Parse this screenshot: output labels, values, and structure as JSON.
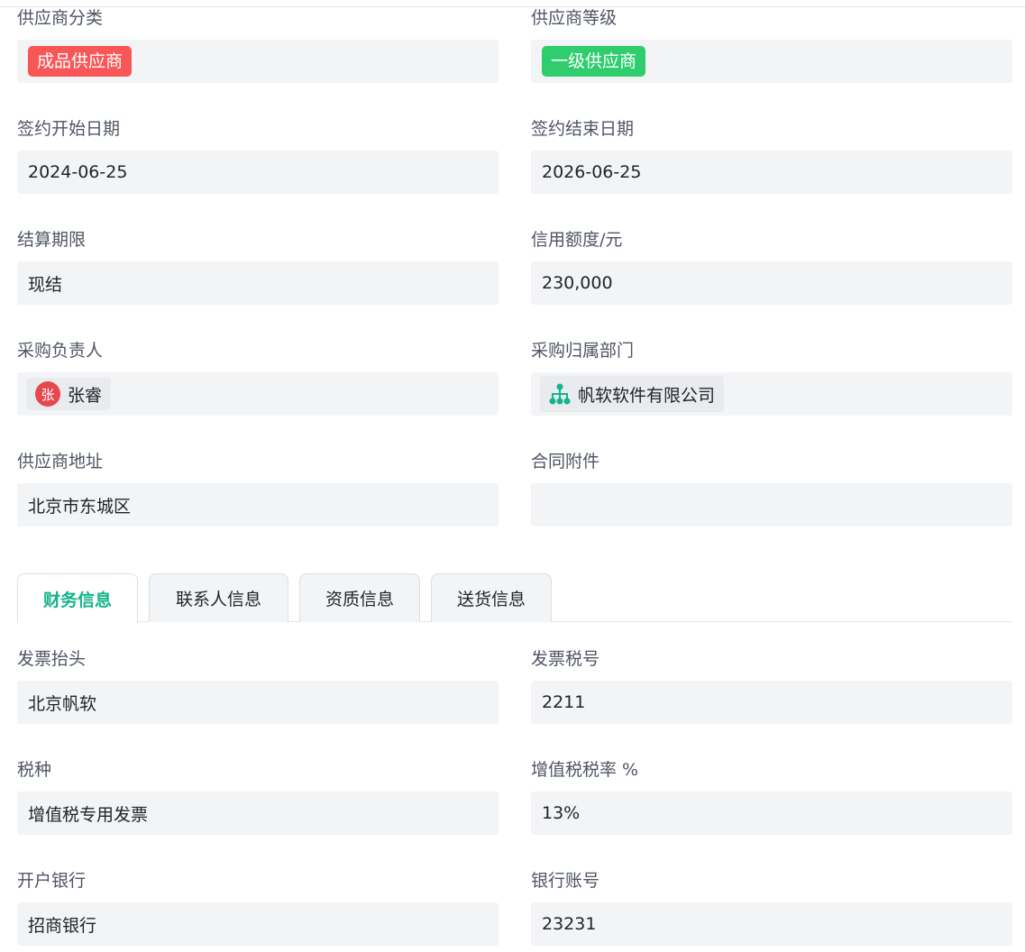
{
  "basic": {
    "supplier_category": {
      "label": "供应商分类",
      "value": "成品供应商",
      "color": "#f95757"
    },
    "supplier_level": {
      "label": "供应商等级",
      "value": "一级供应商",
      "color": "#2fcd6e"
    },
    "start_date": {
      "label": "签约开始日期",
      "value": "2024-06-25"
    },
    "end_date": {
      "label": "签约结束日期",
      "value": "2026-06-25"
    },
    "settlement": {
      "label": "结算期限",
      "value": "现结"
    },
    "credit": {
      "label": "信用额度/元",
      "value": "230,000"
    },
    "buyer": {
      "label": "采购负责人",
      "avatar": "张",
      "value": "张睿"
    },
    "department": {
      "label": "采购归属部门",
      "icon": "org-chart-icon",
      "value": "帆软软件有限公司"
    },
    "address": {
      "label": "供应商地址",
      "value": "北京市东城区"
    },
    "attachment": {
      "label": "合同附件",
      "value": ""
    }
  },
  "tabs": [
    {
      "label": "财务信息",
      "active": true
    },
    {
      "label": "联系人信息"
    },
    {
      "label": "资质信息"
    },
    {
      "label": "送货信息"
    }
  ],
  "finance": {
    "invoice_title": {
      "label": "发票抬头",
      "value": "北京帆软"
    },
    "tax_no": {
      "label": "发票税号",
      "value": "2211"
    },
    "tax_type": {
      "label": "税种",
      "value": "增值税专用发票"
    },
    "vat_rate": {
      "label": "增值税税率 %",
      "value": "13%"
    },
    "bank": {
      "label": "开户银行",
      "value": "招商银行"
    },
    "account": {
      "label": "银行账号",
      "value": "23231"
    }
  },
  "accent": "#14b38a"
}
